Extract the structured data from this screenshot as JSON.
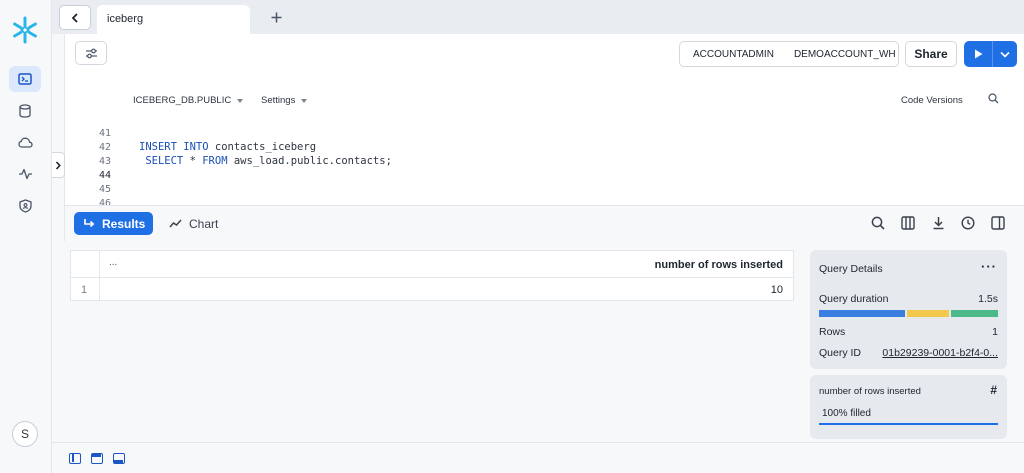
{
  "app": {
    "tab_title": "iceberg",
    "user_initial": "S"
  },
  "header": {
    "role": "ACCOUNTADMIN",
    "warehouse": "DEMOACCOUNT_WH",
    "share_label": "Share"
  },
  "context": {
    "database": "ICEBERG_DB.PUBLIC",
    "settings": "Settings",
    "code_versions": "Code Versions"
  },
  "editor": {
    "line_numbers": [
      "41",
      "42",
      "43",
      "44",
      "45",
      "46"
    ],
    "current_line": "44",
    "code": [
      {
        "kw1": "",
        "text1": "",
        "kw2": "",
        "text2": ""
      },
      {
        "kw1": "INSERT INTO",
        "text1": " contacts_iceberg",
        "kw2": "",
        "text2": ""
      },
      {
        "kw1": " SELECT",
        "text1": " * ",
        "kw2": "FROM",
        "text2": " aws_load.public.contacts;"
      }
    ]
  },
  "results": {
    "results_label": "Results",
    "chart_label": "Chart",
    "header_dots": "...",
    "columns": [
      "number of rows inserted"
    ],
    "rows": [
      {
        "index": "1",
        "values": [
          "10"
        ]
      }
    ]
  },
  "query_details": {
    "title": "Query Details",
    "menu": "···",
    "duration_label": "Query duration",
    "duration_value": "1.5s",
    "rows_label": "Rows",
    "rows_value": "1",
    "query_id_label": "Query ID",
    "query_id_value": "01b29239-0001-b2f4-0..."
  },
  "column_stats": {
    "name": "number of rows inserted",
    "type_symbol": "#",
    "filled_text": "100% filled",
    "filled_fraction": 1.0
  },
  "colors": {
    "accent": "#1f6fe5",
    "bar_blue": "#3a7fe0",
    "bar_yellow": "#f2c94c",
    "bar_green": "#4cb98a"
  }
}
